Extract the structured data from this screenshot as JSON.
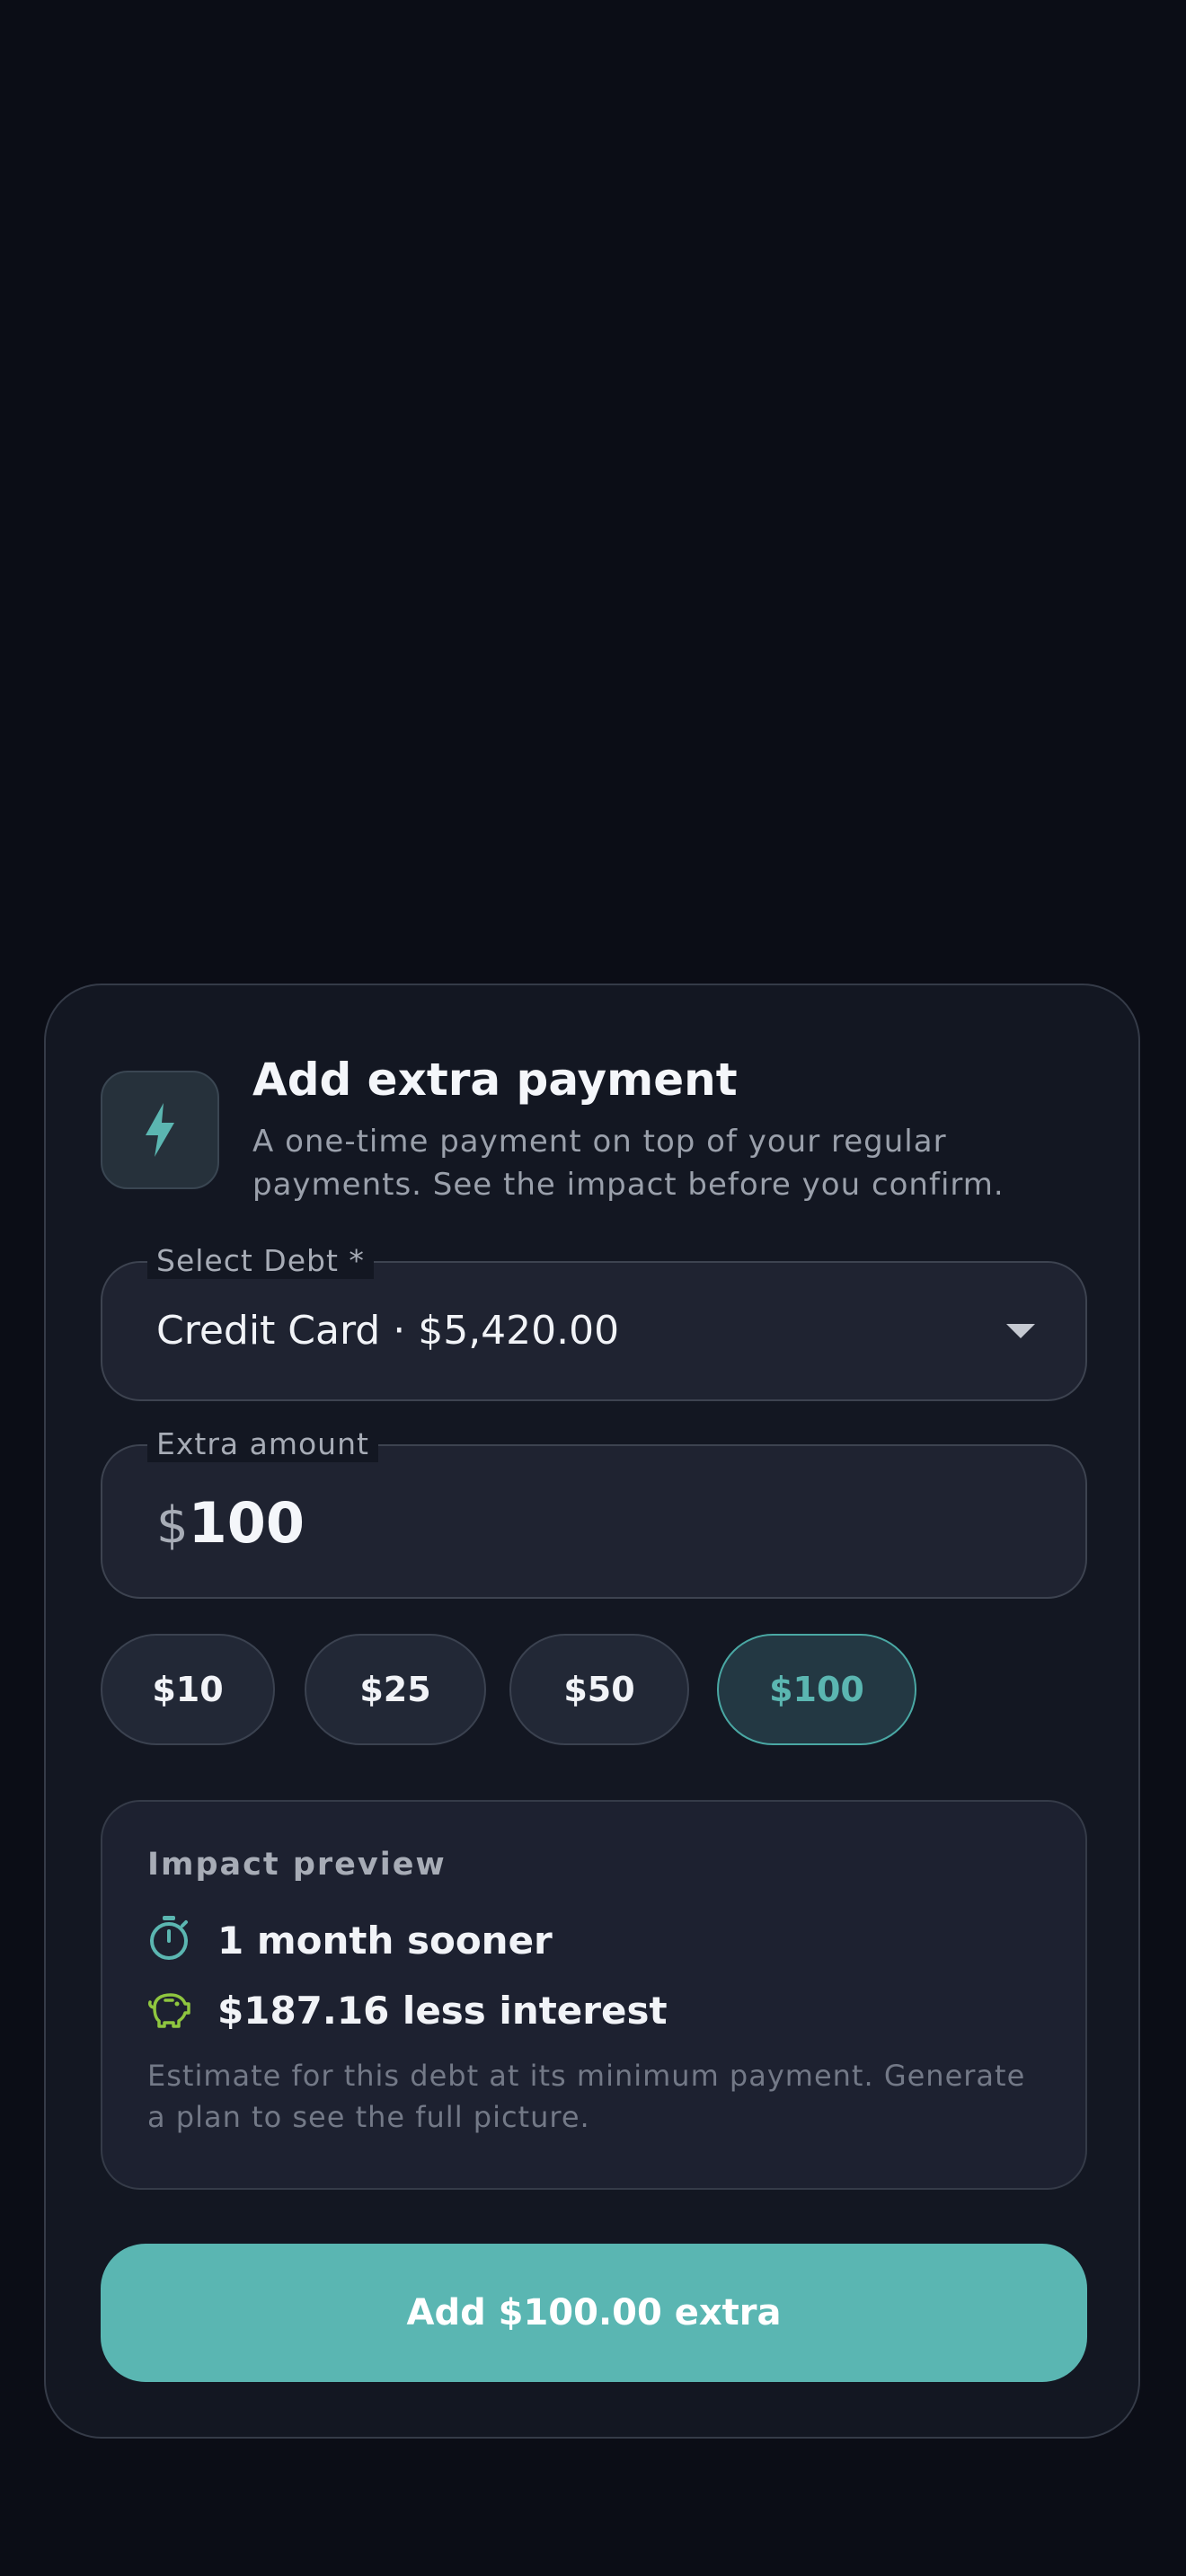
{
  "dialog": {
    "title": "Add extra payment",
    "subtitle": "A one-time payment on top of your regular payments. See the impact before you confirm.",
    "header_icon": "lightning-bolt-icon"
  },
  "select_debt": {
    "label": "Select Debt *",
    "value": "Credit Card · $5,420.00"
  },
  "extra_amount": {
    "label": "Extra amount",
    "currency": "$",
    "value": "100"
  },
  "quick_amounts": [
    {
      "label": "$10",
      "selected": false
    },
    {
      "label": "$25",
      "selected": false
    },
    {
      "label": "$50",
      "selected": false
    },
    {
      "label": "$100",
      "selected": true
    }
  ],
  "impact": {
    "title": "Impact preview",
    "rows": [
      {
        "icon": "stopwatch-icon",
        "text": "1 month sooner"
      },
      {
        "icon": "piggy-bank-icon",
        "text": "$187.16 less interest"
      }
    ],
    "note": "Estimate for this debt at its minimum payment. Generate a plan to see the full picture."
  },
  "cta_label": "Add $100.00 extra",
  "colors": {
    "background": "#0b0d16",
    "surface": "#131722",
    "accent": "#5ab6b2",
    "green_icon": "#8fc63f"
  }
}
